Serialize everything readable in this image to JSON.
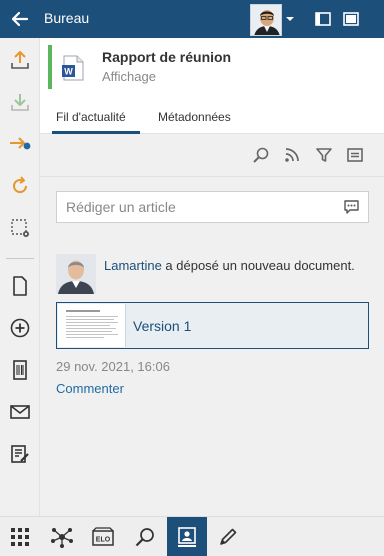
{
  "topbar": {
    "title": "Bureau",
    "icons": [
      "back-arrow-icon",
      "user-avatar",
      "caret-down-icon",
      "window-restore-icon",
      "window-maximize-icon"
    ]
  },
  "sidebar": {
    "items": [
      {
        "name": "upload-icon",
        "color": "#e8962e"
      },
      {
        "name": "download-icon",
        "color": "#8fbc8f"
      },
      {
        "name": "checkin-icon",
        "color": "#e8962e"
      },
      {
        "name": "refresh-icon",
        "color": "#e8962e"
      },
      {
        "name": "select-settings-icon",
        "color": "#555555"
      },
      {
        "name": "new-document-icon",
        "color": "#333333"
      },
      {
        "name": "add-circle-icon",
        "color": "#333333"
      },
      {
        "name": "barcode-icon",
        "color": "#333333"
      },
      {
        "name": "mail-icon",
        "color": "#333333"
      },
      {
        "name": "edit-list-icon",
        "color": "#333333"
      }
    ]
  },
  "document": {
    "name": "Rapport de réunion",
    "subtitle": "Affichage",
    "status_color": "#5bb55b",
    "file_icon": "word-icon"
  },
  "tabs": [
    {
      "label": "Fil d'actualité",
      "active": true
    },
    {
      "label": "Métadonnées",
      "active": false
    }
  ],
  "toolbar": {
    "icons": [
      "search-icon",
      "rss-icon",
      "filter-icon",
      "list-view-icon"
    ]
  },
  "compose": {
    "placeholder": "Rédiger un article",
    "value": ""
  },
  "post": {
    "author": "Lamartine",
    "action": " a déposé un nouveau document.",
    "version_label": "Version 1",
    "timestamp": "29 nov. 2021, 16:06",
    "comment_label": "Commenter"
  },
  "bottombar": {
    "items": [
      {
        "name": "apps-grid-icon",
        "active": false
      },
      {
        "name": "network-icon",
        "active": false
      },
      {
        "name": "elo-icon",
        "label": "ELO",
        "active": false
      },
      {
        "name": "search-icon",
        "active": false
      },
      {
        "name": "user-card-icon",
        "active": true
      },
      {
        "name": "pen-icon",
        "active": false
      }
    ]
  },
  "colors": {
    "accent": "#1d4f7b",
    "link": "#1d6ba5",
    "sidebar_bg": "#f0f0f0",
    "content_bg": "#f0f0f0"
  }
}
